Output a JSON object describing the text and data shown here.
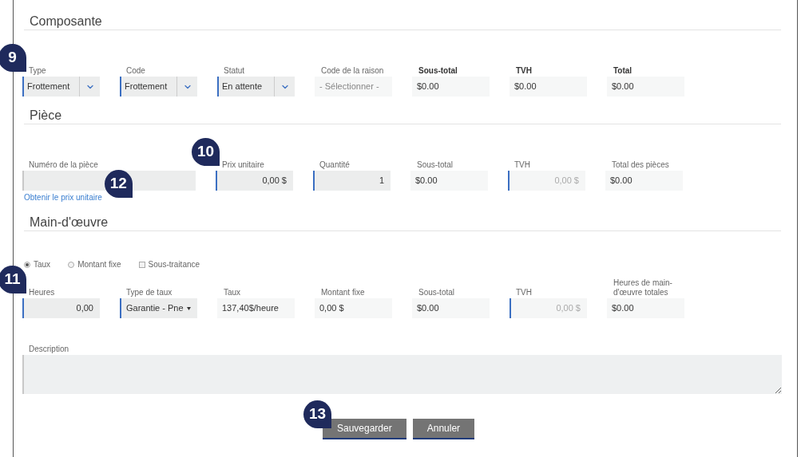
{
  "sections": [
    {
      "title": "Composante",
      "fields": [
        {
          "label": "Type",
          "kind": "dropdown",
          "value": "Frottement",
          "required": true,
          "callout": "9"
        },
        {
          "label": "Code",
          "kind": "dropdown",
          "value": "Frottement",
          "required": true
        },
        {
          "label": "Statut",
          "kind": "dropdown",
          "value": "En attente",
          "required": true
        },
        {
          "label": "Code de la raison",
          "kind": "display",
          "value": "- Sélectionner -",
          "disabled": true
        },
        {
          "label": "Sous-total",
          "kind": "summary",
          "value": "$0.00"
        },
        {
          "label": "TVH",
          "kind": "summary",
          "value": "$0.00"
        },
        {
          "label": "Total",
          "kind": "summary",
          "value": "$0.00"
        }
      ]
    },
    {
      "title": "Pièce",
      "fields": [
        {
          "label": "Numéro de la pièce",
          "kind": "text",
          "required": false,
          "link": "Obtenir le prix unitaire",
          "link_callout": "12"
        },
        {
          "label": "Prix unitaire",
          "kind": "input",
          "value": "0,00 $",
          "required": true,
          "callout": "10"
        },
        {
          "label": "Quantité",
          "kind": "input",
          "value": "1",
          "required": true
        },
        {
          "label": "Sous-total",
          "kind": "display",
          "value": "$0.00"
        },
        {
          "label": "TVH",
          "kind": "input",
          "value": "0,00 $",
          "required": true,
          "disabled": true
        },
        {
          "label": "Total des pièces",
          "kind": "display",
          "value": "$0.00"
        }
      ]
    },
    {
      "title": "Main-d'œuvre",
      "options": [
        {
          "label": "Taux",
          "kind": "radio",
          "selected": true
        },
        {
          "label": "Montant fixe",
          "kind": "radio",
          "selected": false
        },
        {
          "label": "Sous-traitance",
          "kind": "checkbox",
          "checked": false
        }
      ],
      "fields": [
        {
          "label": "Heures",
          "kind": "input",
          "value": "0,00",
          "required": true,
          "callout": "11"
        },
        {
          "label": "Type de taux",
          "kind": "select",
          "value": "Garantie - Pne",
          "required": true
        },
        {
          "label": "Taux",
          "kind": "display",
          "value": "137,40$/heure"
        },
        {
          "label": "Montant fixe",
          "kind": "display",
          "value": "0,00 $"
        },
        {
          "label": "Sous-total",
          "kind": "display",
          "value": "$0.00"
        },
        {
          "label": "TVH",
          "kind": "input",
          "value": "0,00 $",
          "required": true,
          "disabled": true
        },
        {
          "label": "Heures de main-d'œuvre totales",
          "kind": "display",
          "value": "$0.00"
        }
      ],
      "description": {
        "label": "Description"
      }
    }
  ],
  "buttons": [
    {
      "label": "Sauvegarder",
      "callout": "13"
    },
    {
      "label": "Annuler"
    }
  ]
}
